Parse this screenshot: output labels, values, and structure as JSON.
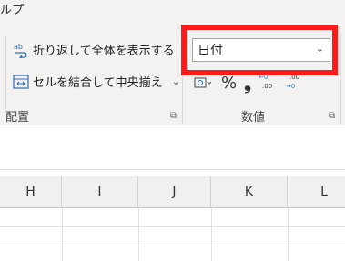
{
  "ribbon": {
    "menu_fragment": "ルプ",
    "wrap_text": {
      "label": "折り返して全体を表示する",
      "icon": "wrap-text-icon"
    },
    "merge_center": {
      "label": "セルを結合して中央揃え",
      "icon": "merge-center-icon"
    },
    "group_alignment": "配置",
    "group_number": "数値",
    "number_format": {
      "value": "日付"
    },
    "number_buttons": {
      "percent": "%",
      "comma": "❟",
      "increase_decimal": "←0 .00",
      "decrease_decimal": ".00 →0"
    }
  },
  "columns": [
    "H",
    "I",
    "J",
    "K",
    "L"
  ],
  "colors": {
    "highlight": "#ff1a1a",
    "ribbon_bg": "#f3f2f1",
    "accent": "#2f6fb5"
  }
}
